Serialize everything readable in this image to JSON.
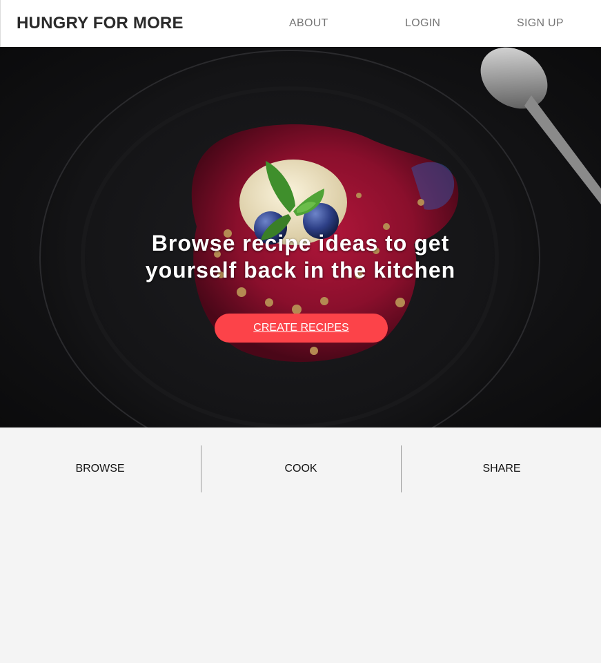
{
  "nav": {
    "brand": "HUNGRY FOR MORE",
    "links": [
      {
        "label": "ABOUT"
      },
      {
        "label": "LOGIN"
      },
      {
        "label": "SIGN UP"
      }
    ]
  },
  "hero": {
    "headline_lines": [
      "Browse recipe ideas to get",
      "yourself back in the kitchen"
    ],
    "cta_label": "CREATE RECIPES"
  },
  "features": {
    "items": [
      {
        "label": "BROWSE"
      },
      {
        "label": "COOK"
      },
      {
        "label": "SHARE"
      }
    ]
  },
  "colors": {
    "accent": "#fc4349",
    "nav_text": "#757575",
    "brand_text": "#2a2a2a",
    "section_bg": "#f4f4f4"
  }
}
